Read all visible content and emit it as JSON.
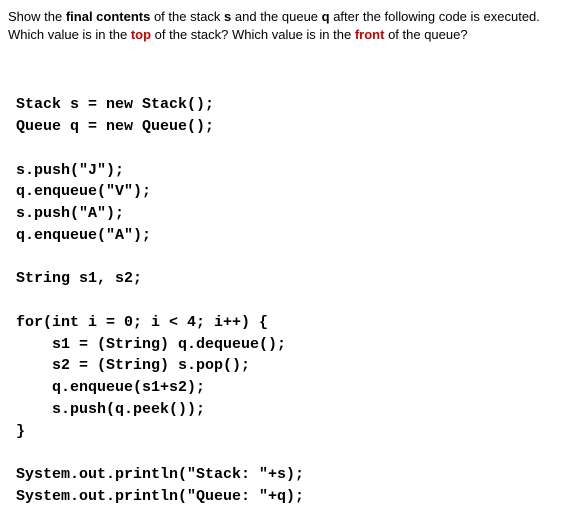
{
  "question": {
    "part1": "Show the ",
    "bold1": "final contents",
    "part2": " of the stack ",
    "bold2": "s",
    "part3": " and the queue ",
    "bold3": "q",
    "part4": " after the following code is executed.",
    "part5": "Which value is in the ",
    "red1": "top",
    "part6": " of the stack? Which value is in the ",
    "red2": "front",
    "part7": " of the queue?"
  },
  "code": "Stack s = new Stack();\nQueue q = new Queue();\n\ns.push(\"J\");\nq.enqueue(\"V\");\ns.push(\"A\");\nq.enqueue(\"A\");\n\nString s1, s2;\n\nfor(int i = 0; i < 4; i++) {\n    s1 = (String) q.dequeue();\n    s2 = (String) s.pop();\n    q.enqueue(s1+s2);\n    s.push(q.peek());\n}\n\nSystem.out.println(\"Stack: \"+s);\nSystem.out.println(\"Queue: \"+q);"
}
